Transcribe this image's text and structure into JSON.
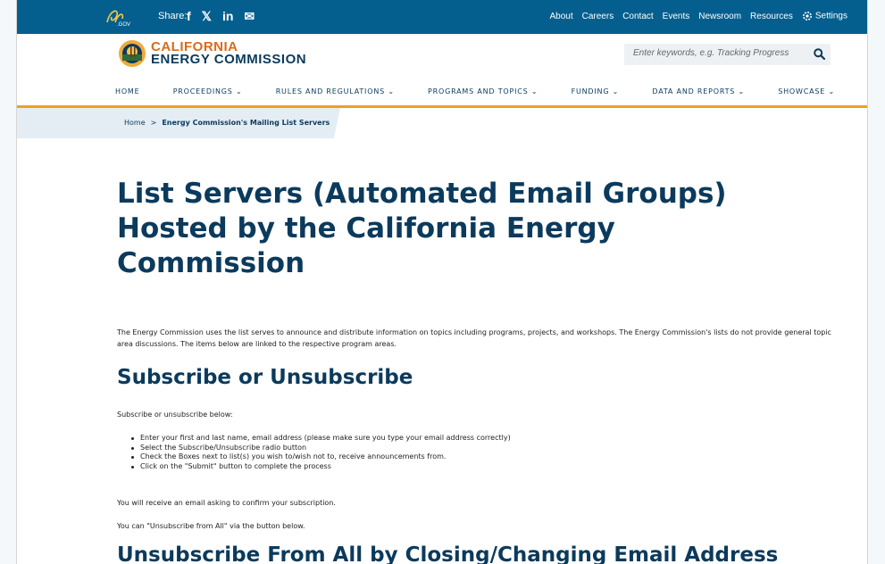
{
  "topbar": {
    "logo_text": "CA.GOV",
    "share_label": "Share:",
    "share_icons": [
      "f",
      "𝕏",
      "in",
      "✉"
    ],
    "links": [
      "About",
      "Careers",
      "Contact",
      "Events",
      "Newsroom",
      "Resources"
    ],
    "settings_label": "Settings"
  },
  "header": {
    "logo_line1": "CALIFORNIA",
    "logo_line2": "ENERGY COMMISSION",
    "search_placeholder": "Enter keywords, e.g. Tracking Progress"
  },
  "nav": {
    "items": [
      "HOME",
      "PROCEEDINGS ⌄",
      "RULES AND REGULATIONS ⌄",
      "PROGRAMS AND TOPICS ⌄",
      "FUNDING ⌄",
      "DATA AND REPORTS ⌄",
      "SHOWCASE ⌄"
    ]
  },
  "breadcrumb": {
    "home": "Home",
    "separator": ">",
    "current": "Energy Commission's Mailing List Servers"
  },
  "content": {
    "title": "List Servers (Automated Email Groups) Hosted by the California Energy Commission",
    "intro": "The Energy Commission uses the list serves to announce and distribute information on topics including programs, projects, and workshops. The Energy Commission's lists do not provide general topic area discussions. The items below are linked to the respective program areas.",
    "h2_subscribe": "Subscribe or Unsubscribe",
    "subscribe_lead": "Subscribe or unsubscribe below:",
    "steps": [
      "Enter your first and last name, email address (please make sure you type your email address correctly)",
      "Select the Subscribe/Unsubscribe radio button",
      "Check the Boxes next to list(s) you wish to/wish not to, receive announcements from.",
      "Click on the \"Submit\" button to complete the process"
    ],
    "confirm_note": "You will receive an email asking to confirm your subscription.",
    "unsubscribe_note": "You can \"Unsubscribe from All\" via the button below.",
    "h2_unsubscribe_all": "Unsubscribe From All by Closing/Changing Email Address"
  },
  "colors": {
    "topbar": "#045f8f",
    "heading": "#0b3a5c",
    "accent": "#f0a020",
    "logo_orange": "#d96b1a"
  }
}
